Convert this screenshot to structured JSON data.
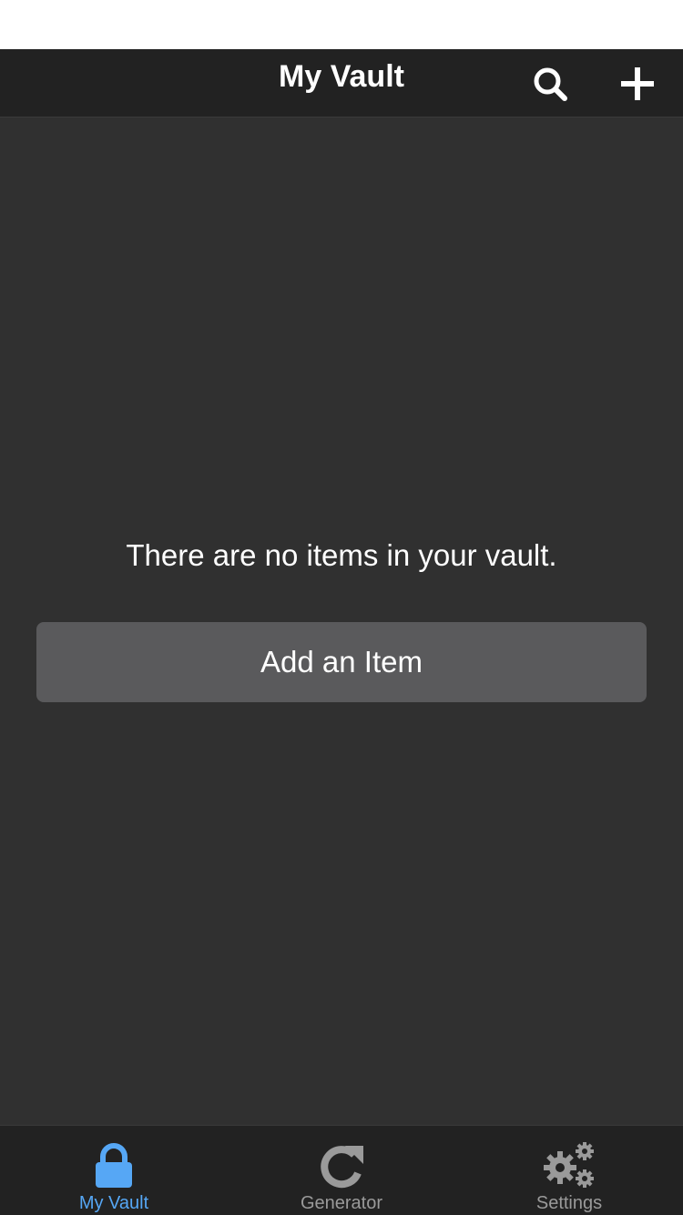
{
  "header": {
    "title": "My Vault",
    "search_icon": "search-icon",
    "add_icon": "plus-icon"
  },
  "main": {
    "empty_message": "There are no items in your vault.",
    "add_button_label": "Add an Item"
  },
  "tabs": [
    {
      "label": "My Vault",
      "icon": "lock-icon",
      "active": true
    },
    {
      "label": "Generator",
      "icon": "refresh-icon",
      "active": false
    },
    {
      "label": "Settings",
      "icon": "gears-icon",
      "active": false
    }
  ],
  "colors": {
    "accent": "#56a7f5",
    "nav_background": "#222222",
    "content_background": "#303030",
    "button_background": "#5a5a5c",
    "inactive_tab": "#9a9a9a"
  }
}
